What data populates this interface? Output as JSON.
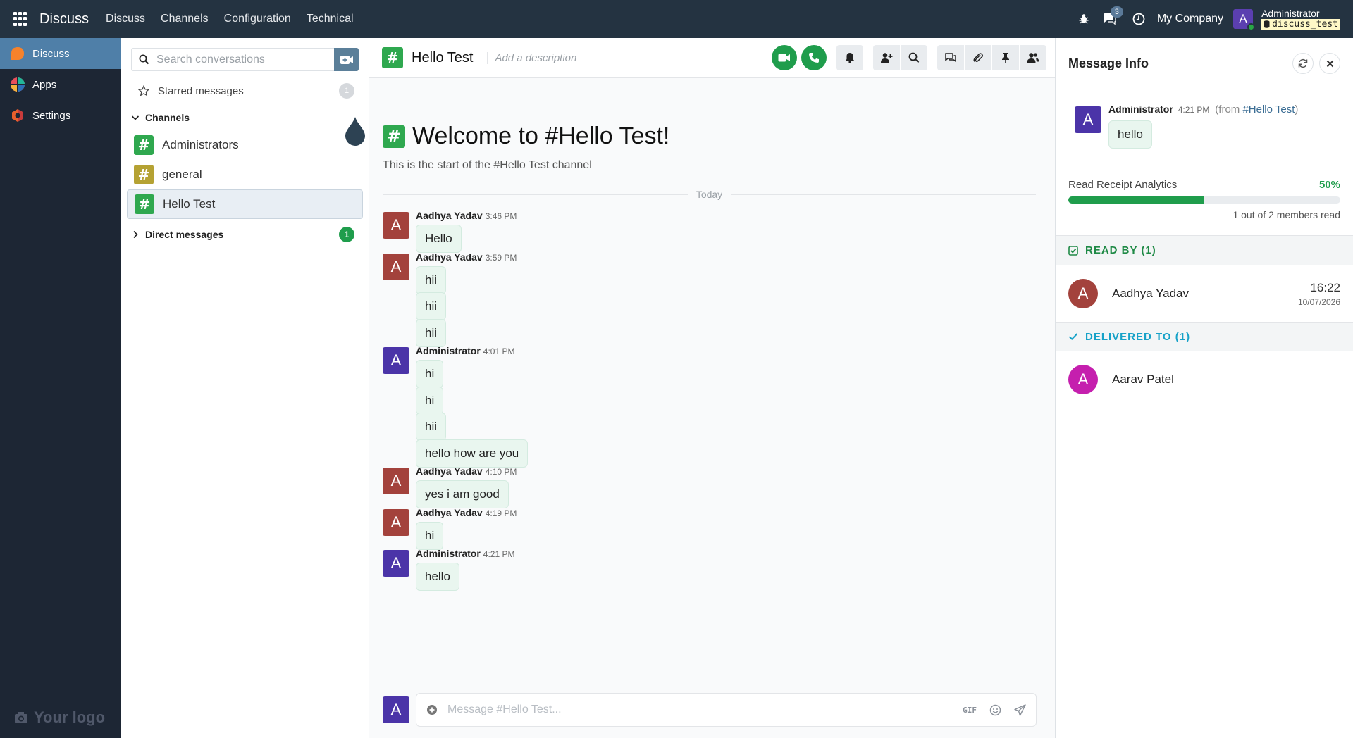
{
  "navbar": {
    "app_name": "Discuss",
    "menus": [
      "Discuss",
      "Channels",
      "Configuration",
      "Technical"
    ],
    "chat_count": "3",
    "company": "My Company",
    "user_initial": "A",
    "user_name": "Administrator",
    "database": "discuss_test",
    "bg_color": "#243341"
  },
  "apps": {
    "items": [
      {
        "label": "Discuss",
        "icon": "discuss-icon"
      },
      {
        "label": "Apps",
        "icon": "apps-icon"
      },
      {
        "label": "Settings",
        "icon": "settings-icon"
      }
    ],
    "logo_text": "Your logo"
  },
  "sidebar": {
    "search_placeholder": "Search conversations",
    "starred": {
      "label": "Starred messages",
      "count": "1"
    },
    "channels_header": "Channels",
    "channels": [
      {
        "name": "Administrators",
        "color": "#2fa84f"
      },
      {
        "name": "general",
        "color": "#b5a233"
      },
      {
        "name": "Hello Test",
        "color": "#2fa84f"
      }
    ],
    "dm_header": "Direct messages",
    "dm_count": "1"
  },
  "thread": {
    "title": "Hello Test",
    "description_placeholder": "Add a description",
    "welcome_title": "Welcome to #Hello Test!",
    "welcome_sub": "This is the start of the #Hello Test channel",
    "day_separator": "Today",
    "messages": [
      {
        "author": "Aadhya Yadav",
        "time": "3:46 PM",
        "initial": "A",
        "color": "#a3423c",
        "bubbles": [
          "Hello"
        ]
      },
      {
        "author": "Aadhya Yadav",
        "time": "3:59 PM",
        "initial": "A",
        "color": "#a3423c",
        "bubbles": [
          "hii",
          "hii",
          "hii"
        ]
      },
      {
        "author": "Administrator",
        "time": "4:01 PM",
        "initial": "A",
        "color": "#4b34a8",
        "bubbles": [
          "hi",
          "hi",
          "hii",
          "hello how are you"
        ]
      },
      {
        "author": "Aadhya Yadav",
        "time": "4:10 PM",
        "initial": "A",
        "color": "#a3423c",
        "bubbles": [
          "yes i am good"
        ]
      },
      {
        "author": "Aadhya Yadav",
        "time": "4:19 PM",
        "initial": "A",
        "color": "#a3423c",
        "bubbles": [
          "hi"
        ]
      },
      {
        "author": "Administrator",
        "time": "4:21 PM",
        "initial": "A",
        "color": "#4b34a8",
        "bubbles": [
          "hello"
        ]
      }
    ],
    "composer_placeholder": "Message #Hello Test...",
    "composer_initial": "A",
    "gif_label": "GIF"
  },
  "info": {
    "title": "Message Info",
    "message": {
      "author": "Administrator",
      "time": "4:21 PM",
      "from_prefix": "(from",
      "from_channel": "#Hello Test",
      "from_suffix": ")",
      "text": "hello",
      "initial": "A"
    },
    "analytics_label": "Read Receipt Analytics",
    "read_percent_label": "50%",
    "read_fraction": 0.5,
    "members_read": "1 out of 2 members read",
    "read_by_label": "READ BY (1)",
    "read_by": [
      {
        "name": "Aadhya Yadav",
        "initial": "A",
        "color": "#a3423c",
        "time": "16:22",
        "date": "10/07/2026"
      }
    ],
    "delivered_label": "DELIVERED TO (1)",
    "delivered_to": [
      {
        "name": "Aarav Patel",
        "initial": "A",
        "color": "#c51fae"
      }
    ]
  }
}
